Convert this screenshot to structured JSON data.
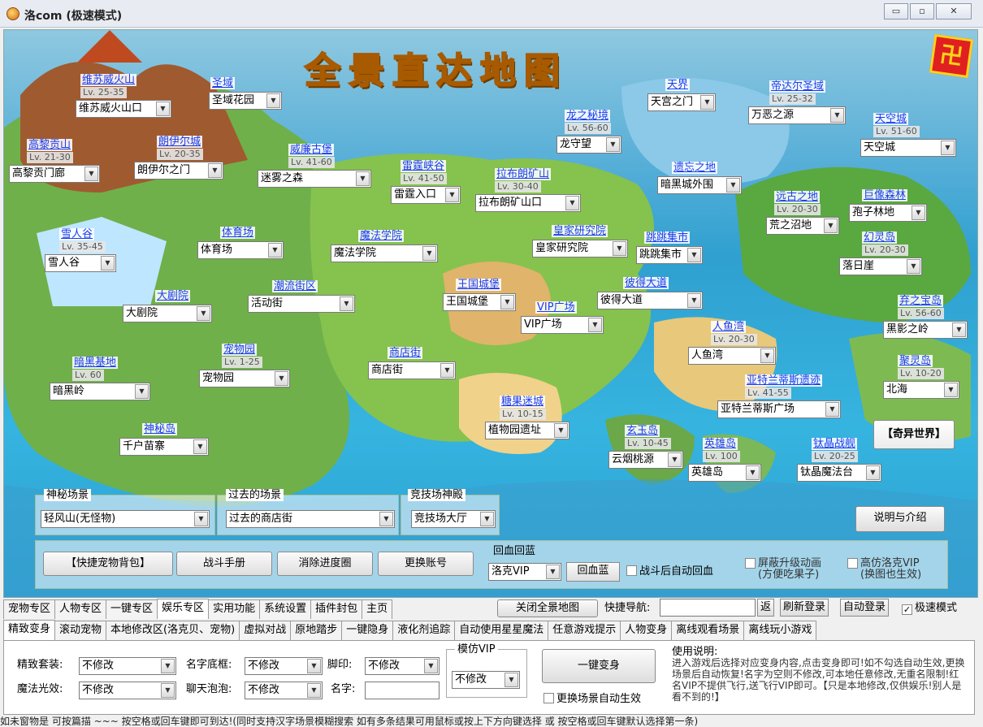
{
  "window": {
    "title": "洛com (极速模式)",
    "buttons": [
      "▭",
      "▫",
      "✕"
    ]
  },
  "map": {
    "title": "全景直达地图",
    "locations": [
      {
        "name": "维苏威火山",
        "level": "Lv. 25-35",
        "select": "维苏威火山口"
      },
      {
        "name": "圣域",
        "level": "",
        "select": "圣域花园"
      },
      {
        "name": "高黎贡山",
        "level": "Lv. 21-30",
        "select": "高黎贡门廊"
      },
      {
        "name": "朗伊尔城",
        "level": "Lv. 20-35",
        "select": "朗伊尔之门"
      },
      {
        "name": "威廉古堡",
        "level": "Lv. 41-60",
        "select": "迷雾之森"
      },
      {
        "name": "雷霆峡谷",
        "level": "Lv. 41-50",
        "select": "雷霆入口"
      },
      {
        "name": "拉布朗矿山",
        "level": "Lv. 30-40",
        "select": "拉布朗矿山口"
      },
      {
        "name": "龙之秘境",
        "level": "Lv. 56-60",
        "select": "龙守望"
      },
      {
        "name": "天界",
        "level": "",
        "select": "天宫之门"
      },
      {
        "name": "帝达尔圣域",
        "level": "Lv. 25-32",
        "select": "万恶之源"
      },
      {
        "name": "天空城",
        "level": "Lv. 51-60",
        "select": "天空城"
      },
      {
        "name": "遗忘之地",
        "level": "",
        "select": "暗黑城外围"
      },
      {
        "name": "远古之地",
        "level": "Lv. 20-30",
        "select": "荒之沼地"
      },
      {
        "name": "巨像森林",
        "level": "",
        "select": "孢子林地"
      },
      {
        "name": "幻灵岛",
        "level": "Lv. 20-30",
        "select": "落日崖"
      },
      {
        "name": "雪人谷",
        "level": "Lv. 35-45",
        "select": "雪人谷"
      },
      {
        "name": "体育场",
        "level": "",
        "select": "体育场"
      },
      {
        "name": "魔法学院",
        "level": "",
        "select": "魔法学院"
      },
      {
        "name": "皇家研究院",
        "level": "",
        "select": "皇家研究院"
      },
      {
        "name": "跳跳集市",
        "level": "",
        "select": "跳跳集市"
      },
      {
        "name": "大剧院",
        "level": "",
        "select": "大剧院"
      },
      {
        "name": "潮流街区",
        "level": "",
        "select": "活动街"
      },
      {
        "name": "王国城堡",
        "level": "",
        "select": "王国城堡"
      },
      {
        "name": "彼得大道",
        "level": "",
        "select": "彼得大道"
      },
      {
        "name": "VIP广场",
        "level": "",
        "select": "VIP广场"
      },
      {
        "name": "弃之宝岛",
        "level": "Lv. 56-60",
        "select": "黑影之岭"
      },
      {
        "name": "人鱼湾",
        "level": "Lv. 20-30",
        "select": "人鱼湾"
      },
      {
        "name": "暗黑基地",
        "level": "Lv. 60",
        "select": "暗黑岭"
      },
      {
        "name": "宠物园",
        "level": "Lv. 1-25",
        "select": "宠物园"
      },
      {
        "name": "商店街",
        "level": "",
        "select": "商店街"
      },
      {
        "name": "聚灵岛",
        "level": "Lv. 10-20",
        "select": "北海"
      },
      {
        "name": "亚特兰蒂斯遗迹",
        "level": "Lv. 41-55",
        "select": "亚特兰蒂斯广场"
      },
      {
        "name": "糖果迷城",
        "level": "Lv. 10-15",
        "select": "植物园遗址"
      },
      {
        "name": "神秘岛",
        "level": "",
        "select": "千户苗寨"
      },
      {
        "name": "玄玉岛",
        "level": "Lv. 10-45",
        "select": "云烟桃源"
      },
      {
        "name": "英雄岛",
        "level": "Lv. 100",
        "select": "英雄岛"
      },
      {
        "name": "钛晶战舰",
        "level": "Lv. 20-25",
        "select": "钛晶魔法台"
      }
    ],
    "special_button": "【奇异世界】",
    "intro_button": "说明与介绍",
    "mystery_scene": {
      "label": "神秘场景",
      "value": "轻风山(无怪物)"
    },
    "past_scene": {
      "label": "过去的场景",
      "value": "过去的商店街"
    },
    "arena": {
      "label": "竞技场神殿",
      "value": "竞技场大厅"
    },
    "quick_pet_button": "【快捷宠物背包】",
    "battle_manual_button": "战斗手册",
    "clear_progress_button": "消除进度圈",
    "switch_account_button": "更换账号",
    "restore": {
      "label": "回血回蓝",
      "select": "洛克VIP",
      "button": "回血蓝",
      "auto_label": "战斗后自动回血"
    },
    "block_upgrade_anim": "屏蔽升级动画\n(方便吃果子)",
    "imitate_vip": "高仿洛克VIP\n(换图也生效)"
  },
  "nav": {
    "tabs": [
      "宠物专区",
      "人物专区",
      "一键专区",
      "娱乐专区",
      "实用功能",
      "系统设置",
      "插件封包",
      "主页"
    ],
    "active_tab": 3,
    "close_map_button": "关闭全景地图",
    "quick_nav_label": "快捷导航:",
    "quick_nav_placeholder": "",
    "go_button": "返",
    "refresh_login": "刷新登录",
    "auto_login": "自动登录",
    "speed_mode": "极速模式"
  },
  "subtabs": [
    "精致变身",
    "滚动宠物",
    "本地修改区(洛克贝、宠物)",
    "虚拟对战",
    "原地踏步",
    "一键隐身",
    "液化剂追踪",
    "自动使用星星魔法",
    "任意游戏提示",
    "人物变身",
    "离线观看场景",
    "离线玩小游戏"
  ],
  "transform": {
    "suit_label": "精致套装:",
    "suit_value": "不修改",
    "frame_label": "名字底框:",
    "frame_value": "不修改",
    "foot_label": "脚印:",
    "foot_value": "不修改",
    "aura_label": "魔法光效:",
    "aura_value": "不修改",
    "bubble_label": "聊天泡泡:",
    "bubble_value": "不修改",
    "name_label": "名字:",
    "name_value": "",
    "vip_label": "模仿VIP",
    "vip_value": "不修改",
    "apply_button": "一键变身",
    "auto_label": "更换场景自动生效",
    "help_title": "使用说明:",
    "help_text": "进入游戏后选择对应变身内容,点击变身即可!如不勾选自动生效,更换场景后自动恢复!名字为空则不修改,可本地任意修改,无重名限制!红名VIP不提供飞行,送飞行VIP即可。【只是本地修改,仅供娱乐!别人是看不到的!】"
  },
  "status_text": "如未窗物是 可按篇描 ~~~ 按空格或回车键即可到达!(同时支持汉字场景模糊搜索 如有多条结果可用鼠标或按上下方向键选择 或 按空格或回车键默认选择第一条)",
  "colors": {
    "link": "#1a3cf0",
    "sea": "#2fa0d0",
    "title_gold": "#ffb020"
  }
}
